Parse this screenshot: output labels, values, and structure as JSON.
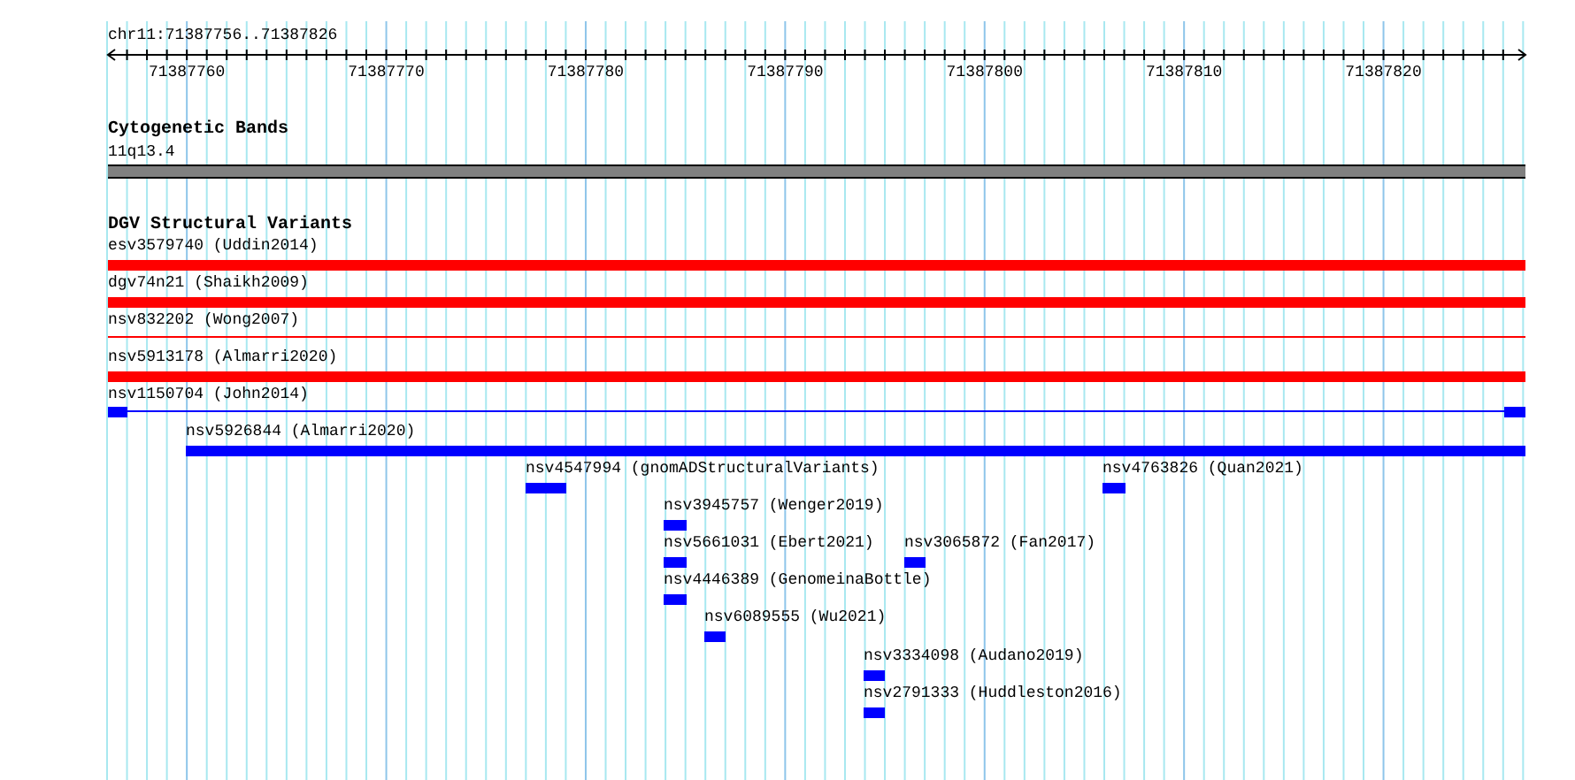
{
  "ruler": {
    "location": "chr11:71387756..71387826",
    "ticks": [
      "71387760",
      "71387770",
      "71387780",
      "71387790",
      "71387800",
      "71387810",
      "71387820"
    ]
  },
  "cytogenetic_track": {
    "title": "Cytogenetic Bands",
    "bands": [
      {
        "label": "11q13.4"
      }
    ]
  },
  "dgv_track": {
    "title": "DGV Structural Variants",
    "features": [
      {
        "label": "esv3579740 (Uddin2014)",
        "kind": "bar",
        "color": "#ff0000"
      },
      {
        "label": "dgv74n21 (Shaikh2009)",
        "kind": "bar",
        "color": "#ff0000"
      },
      {
        "label": "nsv832202 (Wong2007)",
        "kind": "line",
        "color": "#ff0000"
      },
      {
        "label": "nsv5913178 (Almarri2020)",
        "kind": "bar",
        "color": "#ff0000"
      },
      {
        "label": "nsv1150704 (John2014)",
        "kind": "split",
        "color": "#0000ff"
      },
      {
        "label": "nsv5926844 (Almarri2020)",
        "kind": "bar",
        "color": "#0000ff"
      },
      {
        "label": "nsv4547994 (gnomADStructuralVariants)",
        "kind": "bar",
        "color": "#0000ff"
      },
      {
        "label": "nsv4763826 (Quan2021)",
        "kind": "bar",
        "color": "#0000ff"
      },
      {
        "label": "nsv3945757 (Wenger2019)",
        "kind": "bar",
        "color": "#0000ff"
      },
      {
        "label": "nsv5661031 (Ebert2021)",
        "kind": "bar",
        "color": "#0000ff"
      },
      {
        "label": "nsv3065872 (Fan2017)",
        "kind": "bar",
        "color": "#0000ff"
      },
      {
        "label": "nsv4446389 (GenomeinaBottle)",
        "kind": "bar",
        "color": "#0000ff"
      },
      {
        "label": "nsv6089555 (Wu2021)",
        "kind": "bar",
        "color": "#0000ff"
      },
      {
        "label": "nsv3334098 (Audano2019)",
        "kind": "bar",
        "color": "#0000ff"
      },
      {
        "label": "nsv2791333 (Huddleston2016)",
        "kind": "bar",
        "color": "#0000ff"
      }
    ]
  }
}
